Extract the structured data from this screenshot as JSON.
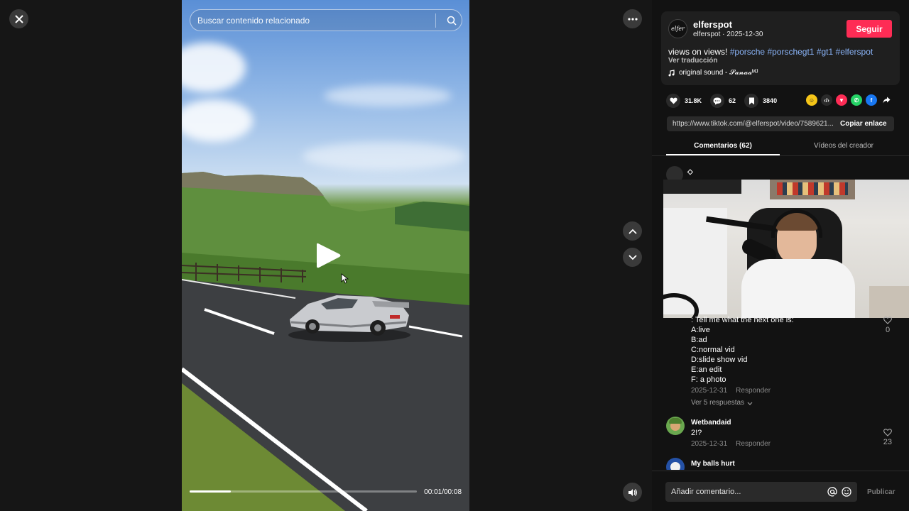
{
  "player": {
    "search_placeholder": "Buscar contenido relacionado",
    "time": "00:01/00:08",
    "progress_fraction": 0.18
  },
  "icons": {
    "close": "close-icon",
    "more": "more-icon",
    "search": "search-icon",
    "play": "play-icon",
    "up": "chevron-up-icon",
    "down": "chevron-down-icon",
    "volume": "volume-icon"
  },
  "creator": {
    "avatar_text": "elfer",
    "username": "elferspot",
    "subline": "elferspot · 2025-12-30",
    "follow_label": "Seguir"
  },
  "post": {
    "text": "views on views!",
    "hashtags": [
      "#porsche",
      "#porschegt1",
      "#gt1",
      "#elferspot"
    ],
    "translate_label": "Ver traducción",
    "sound": "original sound - 𝓢𝓪𝓷𝓪𝓪ᴹᴶ"
  },
  "stats": {
    "likes": "31.8K",
    "comments": "62",
    "saves": "3840"
  },
  "link": {
    "url": "https://www.tiktok.com/@elferspot/video/7589621...",
    "copy_label": "Copiar enlace"
  },
  "tabs": {
    "comments": "Comentarios (62)",
    "creator_videos": "Vídeos del creador"
  },
  "comment1": {
    "name": "◇",
    "lines": [
      ": Tell me what the next one is:",
      "A:live",
      "B:ad",
      "C:normal vid",
      "D:slide show vid",
      "E:an edit",
      "F: a photo"
    ],
    "date": "2025-12-31",
    "reply_label": "Responder",
    "likes": "0",
    "view_replies": "Ver 5 respuestas"
  },
  "comment2": {
    "name": "Wetbandaid",
    "text": "2!?",
    "date": "2025-12-31",
    "reply_label": "Responder",
    "likes": "23"
  },
  "comment3": {
    "name": "My balls hurt"
  },
  "compose": {
    "placeholder": "Añadir comentario...",
    "publish_label": "Publicar"
  },
  "colors": {
    "accent": "#fe2c55",
    "hashtag": "#8ab4f8",
    "panel_bg": "#121212"
  }
}
